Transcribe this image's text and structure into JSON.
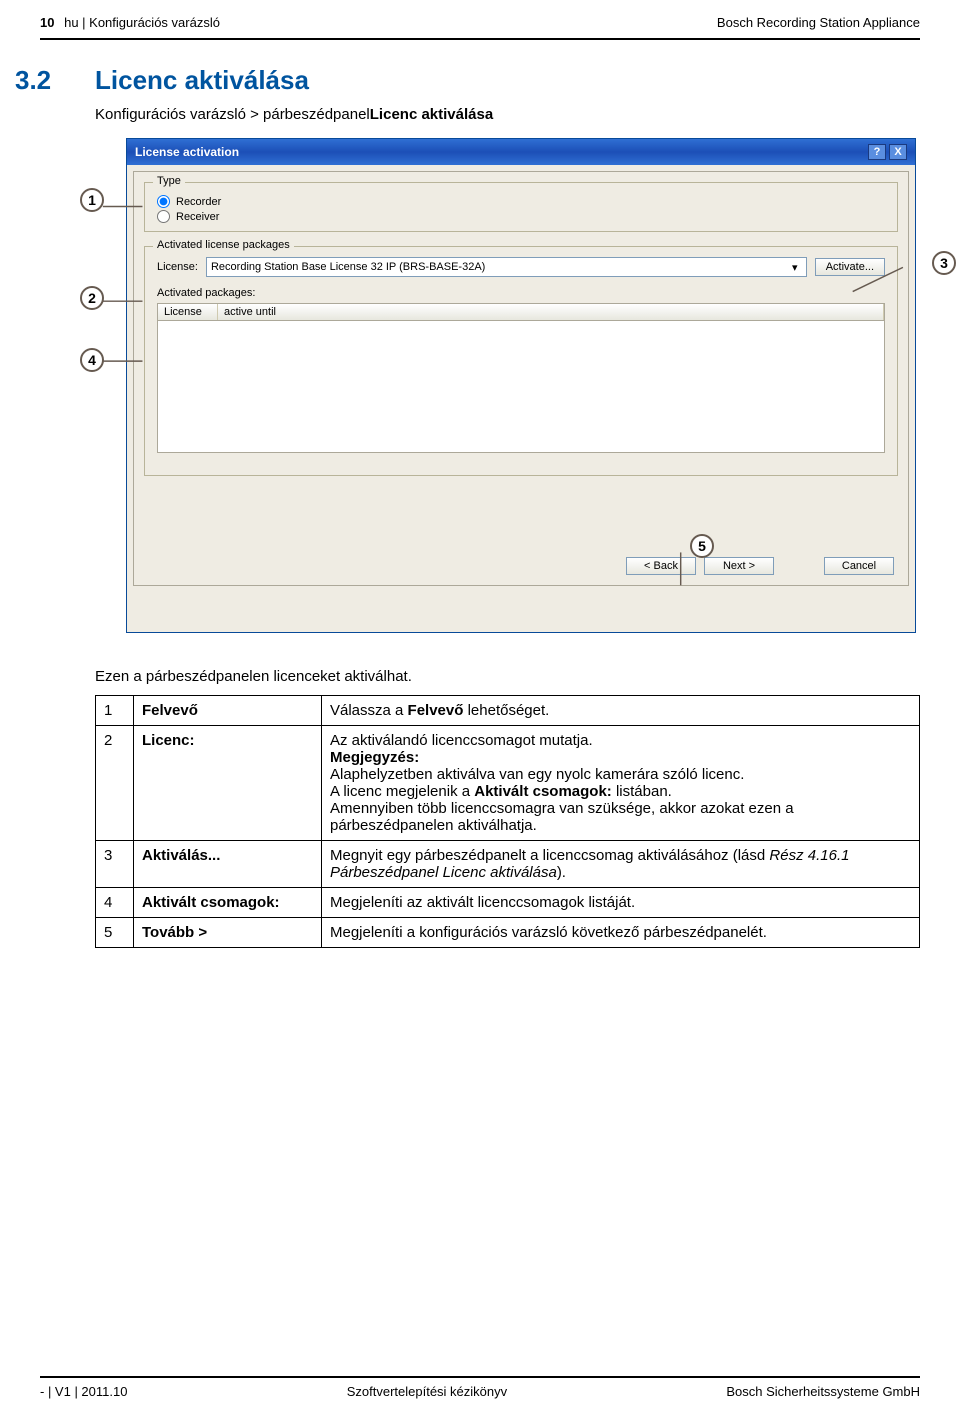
{
  "header": {
    "page_num": "10",
    "left": "hu | Konfigurációs varázsló",
    "right": "Bosch Recording Station Appliance"
  },
  "section": {
    "num": "3.2",
    "title": "Licenc aktiválása",
    "sub_prefix": "Konfigurációs varázsló > párbeszédpanel",
    "sub_bold": "Licenc aktiválása"
  },
  "dialog": {
    "title": "License activation",
    "help_tip": "?",
    "close": "X",
    "type_label": "Type",
    "radio_recorder": "Recorder",
    "radio_receiver": "Receiver",
    "grp_lic": "Activated license packages",
    "license_label": "License:",
    "license_value": "Recording Station Base License 32 IP (BRS-BASE-32A)",
    "activate_btn": "Activate...",
    "act_pkgs": "Activated packages:",
    "col_license": "License",
    "col_until": "active until",
    "btn_back": "< Back",
    "btn_next": "Next >",
    "btn_cancel": "Cancel"
  },
  "callouts": {
    "c1": "1",
    "c2": "2",
    "c3": "3",
    "c4": "4",
    "c5": "5"
  },
  "intro": "Ezen a párbeszédpanelen licenceket aktiválhat.",
  "rows": [
    {
      "n": "1",
      "k": "Felvevő",
      "d_pre": "Válassza a ",
      "d_b": "Felvevő",
      "d_post": " lehetőséget."
    },
    {
      "n": "2",
      "k": "Licenc:",
      "d_line1": "Az aktiválandó licenccsomagot mutatja.",
      "d_note_b": "Megjegyzés:",
      "d_note1": "Alaphelyzetben aktiválva van egy nyolc kamerára szóló licenc.",
      "d_note2_pre": "A licenc megjelenik a ",
      "d_note2_b": "Aktivált csomagok:",
      "d_note2_post": " listában.",
      "d_note3": "Amennyiben több licenccsomagra van szüksége, akkor azokat ezen a párbeszédpanelen aktiválhatja."
    },
    {
      "n": "3",
      "k": "Aktiválás...",
      "d_line1": "Megnyit egy párbeszédpanelt a licenccsomag aktiválásához",
      "d_ref_pre": "(lásd ",
      "d_ref_i": "Rész 4.16.1 Párbeszédpanel Licenc aktiválása",
      "d_ref_post": ")."
    },
    {
      "n": "4",
      "k": "Aktivált csomagok:",
      "d_line1": "Megjeleníti az aktivált licenccsomagok listáját."
    },
    {
      "n": "5",
      "k": "Tovább >",
      "d_line1": "Megjeleníti a konfigurációs varázsló következő párbeszédpanelét."
    }
  ],
  "footer": {
    "left": "- | V1 | 2011.10",
    "center": "Szoftvertelepítési kézikönyv",
    "right": "Bosch Sicherheitssysteme GmbH"
  }
}
